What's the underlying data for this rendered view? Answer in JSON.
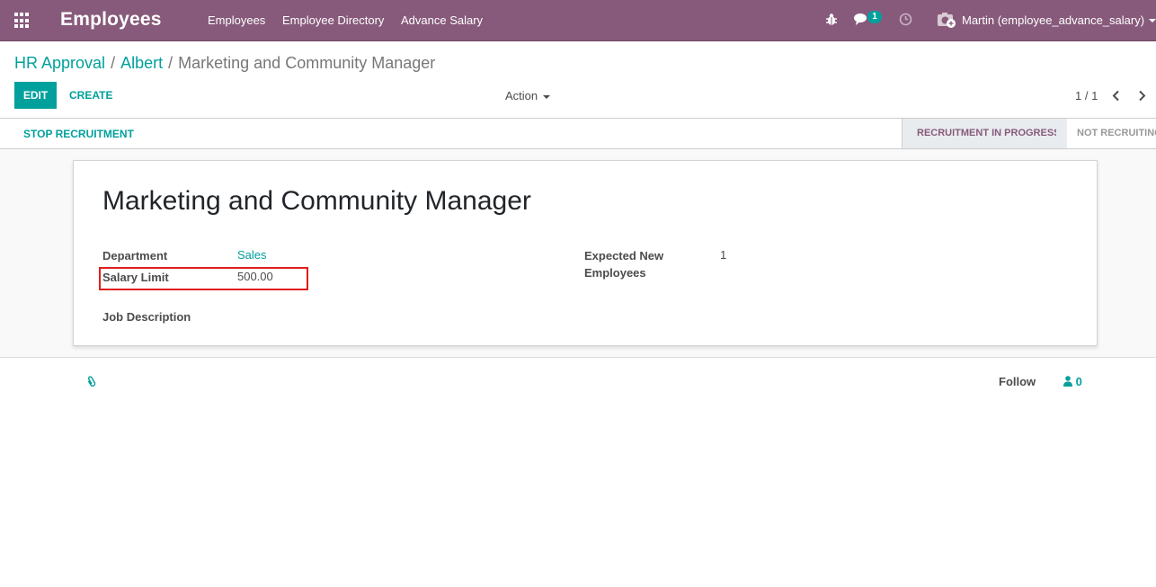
{
  "navbar": {
    "app_title": "Employees",
    "menu": [
      "Employees",
      "Employee Directory",
      "Advance Salary"
    ],
    "message_count": "1",
    "user_name": "Martin (employee_advance_salary)"
  },
  "breadcrumb": {
    "items": [
      "HR Approval",
      "Albert"
    ],
    "current": "Marketing and Community Manager"
  },
  "control_panel": {
    "edit_label": "EDIT",
    "create_label": "CREATE",
    "action_label": "Action",
    "pager": "1 / 1"
  },
  "statusbar": {
    "stop_label": "STOP RECRUITMENT",
    "stages": [
      "RECRUITMENT IN PROGRESS",
      "NOT RECRUITING"
    ],
    "active_stage": "RECRUITMENT IN PROGRESS"
  },
  "form": {
    "title": "Marketing and Community Manager",
    "department_label": "Department",
    "department_value": "Sales",
    "salary_limit_label": "Salary Limit",
    "salary_limit_value": "500.00",
    "expected_label_line1": "Expected New",
    "expected_label_line2": "Employees",
    "expected_value": "1",
    "job_description_label": "Job Description"
  },
  "chatter": {
    "follow_label": "Follow",
    "followers_count": "0"
  },
  "colors": {
    "brand": "#875a7b",
    "accent": "#00a09d",
    "highlight": "#e11d1d"
  }
}
